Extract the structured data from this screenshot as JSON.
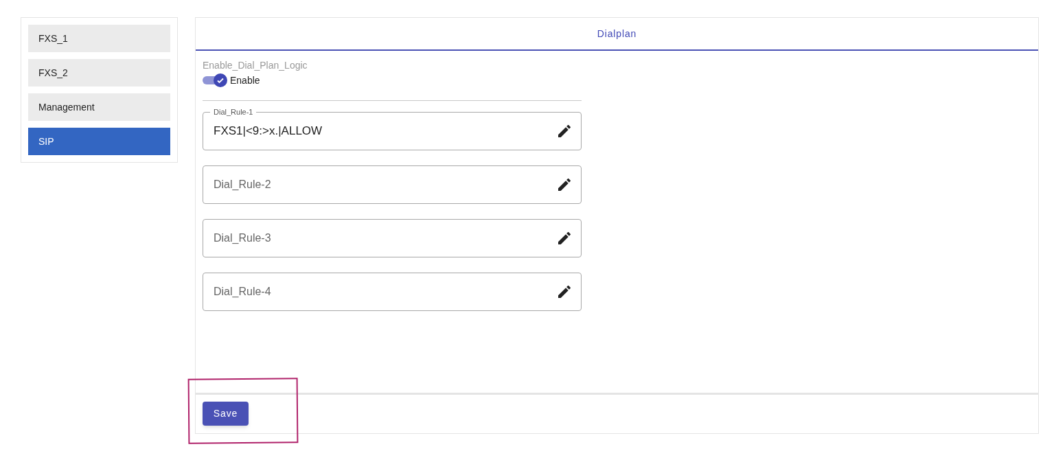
{
  "sidebar": {
    "items": [
      {
        "label": "FXS_1",
        "selected": false
      },
      {
        "label": "FXS_2",
        "selected": false
      },
      {
        "label": "Management",
        "selected": false
      },
      {
        "label": "SIP",
        "selected": true
      }
    ]
  },
  "tabs": [
    {
      "label": "Dialplan",
      "selected": true
    }
  ],
  "enable_dial_plan_logic": {
    "label": "Enable_Dial_Plan_Logic",
    "switch_label": "Enable",
    "on": true
  },
  "dial_rules": [
    {
      "label": "Dial_Rule-1",
      "value": "FXS1|<9:>x.|ALLOW"
    },
    {
      "label": "Dial_Rule-2"
    },
    {
      "label": "Dial_Rule-3"
    },
    {
      "label": "Dial_Rule-4"
    }
  ],
  "save_button": "Save"
}
